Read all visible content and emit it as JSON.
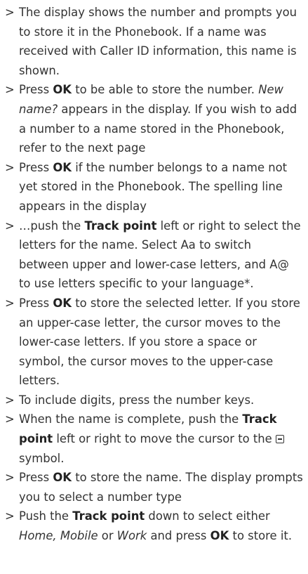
{
  "marker": ">",
  "steps": [
    {
      "segments": [
        {
          "t": "The display shows the number and prompts you to store it in the Phonebook. If a name was received with Caller ID information, this name is shown."
        }
      ]
    },
    {
      "segments": [
        {
          "t": "Press "
        },
        {
          "t": "OK",
          "s": "b"
        },
        {
          "t": " to be able to store the number. "
        },
        {
          "t": "New name?",
          "s": "i"
        },
        {
          "t": " appears in the display. If you wish to add a number to a name stored in the Phonebook, refer to the next page"
        }
      ]
    },
    {
      "segments": [
        {
          "t": "Press "
        },
        {
          "t": "OK",
          "s": "b"
        },
        {
          "t": " if the number belongs to a name not yet stored in the Phonebook. The spelling line appears in the display"
        }
      ]
    },
    {
      "segments": [
        {
          "t": "…push the "
        },
        {
          "t": "Track point",
          "s": "b"
        },
        {
          "t": " left or right to select the letters for the name. Select Aa to switch between upper and lower-case letters, and A@ to use letters specific to your language*."
        }
      ]
    },
    {
      "segments": [
        {
          "t": "Press "
        },
        {
          "t": "OK",
          "s": "b"
        },
        {
          "t": " to store the selected letter. If you store an upper-case letter, the cursor moves to the lower-case letters. If you store a space or symbol, the cursor moves to the upper-case letters."
        }
      ]
    },
    {
      "segments": [
        {
          "t": "To include digits, press the number keys."
        }
      ]
    },
    {
      "segments": [
        {
          "t": "When the name is complete, push the "
        },
        {
          "t": "Track point",
          "s": "b"
        },
        {
          "t": " left or right to move the cursor to the "
        },
        {
          "icon": "store-symbol-icon"
        },
        {
          "t": "symbol."
        }
      ]
    },
    {
      "segments": [
        {
          "t": "Press "
        },
        {
          "t": "OK",
          "s": "b"
        },
        {
          "t": " to store the name. The display prompts you to select a number type"
        }
      ]
    },
    {
      "segments": [
        {
          "t": "Push the "
        },
        {
          "t": "Track point",
          "s": "b"
        },
        {
          "t": " down to select either "
        },
        {
          "t": "Home, Mobile",
          "s": "i"
        },
        {
          "t": " or "
        },
        {
          "t": "Work",
          "s": "i"
        },
        {
          "t": " and press "
        },
        {
          "t": "OK",
          "s": "b"
        },
        {
          "t": " to store it."
        }
      ]
    }
  ]
}
